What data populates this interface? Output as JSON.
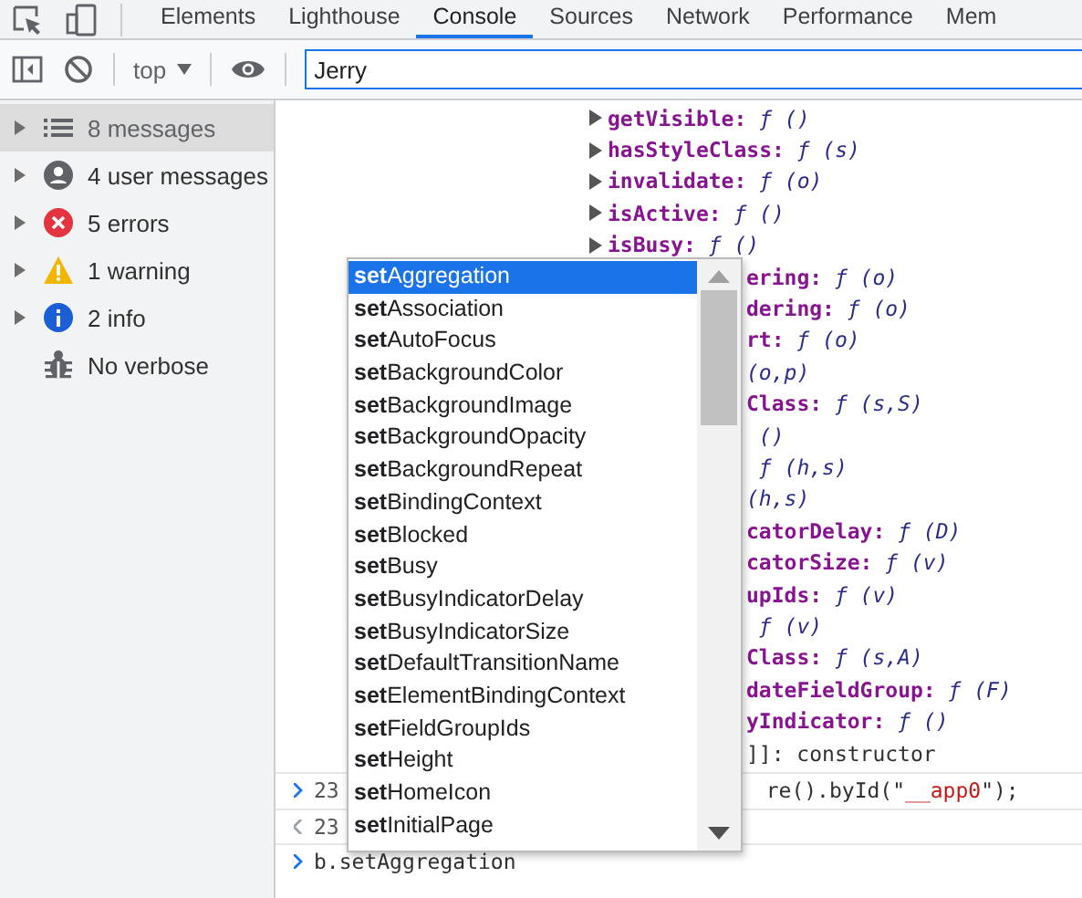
{
  "tabs": [
    {
      "label": "Elements",
      "selected": false
    },
    {
      "label": "Lighthouse",
      "selected": false
    },
    {
      "label": "Console",
      "selected": true
    },
    {
      "label": "Sources",
      "selected": false
    },
    {
      "label": "Network",
      "selected": false
    },
    {
      "label": "Performance",
      "selected": false
    },
    {
      "label": "Mem",
      "selected": false
    }
  ],
  "toolbar": {
    "context": "top",
    "filter": {
      "value": "Jerry"
    }
  },
  "sidebar": {
    "items": [
      {
        "kind": "list",
        "label": "8 messages",
        "expandable": true,
        "selected": true
      },
      {
        "kind": "user",
        "label": "4 user messages",
        "expandable": true,
        "selected": false
      },
      {
        "kind": "error",
        "label": "5 errors",
        "expandable": true,
        "selected": false
      },
      {
        "kind": "warning",
        "label": "1 warning",
        "expandable": true,
        "selected": false
      },
      {
        "kind": "info",
        "label": "2 info",
        "expandable": true,
        "selected": false
      },
      {
        "kind": "verbose",
        "label": "No verbose",
        "expandable": false,
        "selected": false
      }
    ]
  },
  "console": {
    "properties": [
      {
        "kind": "method",
        "key": "getVisible:",
        "value": "ƒ ()",
        "expandable": true
      },
      {
        "kind": "method",
        "key": "hasStyleClass:",
        "value": "ƒ (s)",
        "expandable": true
      },
      {
        "kind": "method",
        "key": "invalidate:",
        "value": "ƒ (o)",
        "expandable": true
      },
      {
        "kind": "method",
        "key": "isActive:",
        "value": "ƒ ()",
        "expandable": true
      },
      {
        "kind": "method",
        "key": "isBusy:",
        "value": "ƒ ()",
        "expandable": true
      },
      {
        "kind": "method",
        "key": "ering:",
        "value": "ƒ (o)",
        "expandable": false
      },
      {
        "kind": "method",
        "key": "dering:",
        "value": "ƒ (o)",
        "expandable": false
      },
      {
        "kind": "method",
        "key": "rt:",
        "value": "ƒ (o)",
        "expandable": false
      },
      {
        "kind": "method",
        "value": "(o,p)",
        "expandable": false
      },
      {
        "kind": "method",
        "key": "Class:",
        "value": "ƒ (s,S)",
        "expandable": false
      },
      {
        "kind": "method",
        "value": " ()",
        "expandable": false
      },
      {
        "kind": "method",
        "value": " ƒ (h,s)",
        "expandable": false
      },
      {
        "kind": "method",
        "value": "(h,s)",
        "expandable": false
      },
      {
        "kind": "method",
        "key": "catorDelay:",
        "value": "ƒ (D)",
        "expandable": false
      },
      {
        "kind": "method",
        "key": "catorSize:",
        "value": "ƒ (v)",
        "expandable": false
      },
      {
        "kind": "method",
        "key": "upIds:",
        "value": "ƒ (v)",
        "expandable": false
      },
      {
        "kind": "method",
        "value": " ƒ (v)",
        "expandable": false
      },
      {
        "kind": "method",
        "key": "Class:",
        "value": "ƒ (s,A)",
        "expandable": false
      },
      {
        "kind": "method",
        "key": "dateFieldGroup:",
        "value": "ƒ (F)",
        "expandable": false
      },
      {
        "kind": "method",
        "key": "yIndicator:",
        "value": "ƒ ()",
        "expandable": false
      },
      {
        "kind": "proto",
        "key": "]]:",
        "value": "constructor",
        "expandable": false
      }
    ],
    "commands": [
      {
        "kind": "input",
        "line": "23",
        "parts": [
          {
            "kind": "code",
            "text": "re().byId(\""
          },
          {
            "kind": "string",
            "text": "__app0"
          },
          {
            "kind": "code",
            "text": "\");"
          }
        ]
      },
      {
        "kind": "output",
        "line": "23"
      },
      {
        "kind": "input",
        "parts": [
          {
            "kind": "code",
            "text": "b.setAggregation"
          }
        ]
      }
    ]
  },
  "autocomplete": {
    "items": [
      {
        "text": "**set**Aggregation",
        "selected": true
      },
      {
        "text": "**set**Association",
        "selected": false
      },
      {
        "text": "**set**AutoFocus",
        "selected": false
      },
      {
        "text": "**set**BackgroundColor",
        "selected": false
      },
      {
        "text": "**set**BackgroundImage",
        "selected": false
      },
      {
        "text": "**set**BackgroundOpacity",
        "selected": false
      },
      {
        "text": "**set**BackgroundRepeat",
        "selected": false
      },
      {
        "text": "**set**BindingContext",
        "selected": false
      },
      {
        "text": "**set**Blocked",
        "selected": false
      },
      {
        "text": "**set**Busy",
        "selected": false
      },
      {
        "text": "**set**BusyIndicatorDelay",
        "selected": false
      },
      {
        "text": "**set**BusyIndicatorSize",
        "selected": false
      },
      {
        "text": "**set**DefaultTransitionName",
        "selected": false
      },
      {
        "text": "**set**ElementBindingContext",
        "selected": false
      },
      {
        "text": "**set**FieldGroupIds",
        "selected": false
      },
      {
        "text": "**set**Height",
        "selected": false
      },
      {
        "text": "**set**HomeIcon",
        "selected": false
      },
      {
        "text": "**set**InitialPage",
        "selected": false
      }
    ]
  }
}
